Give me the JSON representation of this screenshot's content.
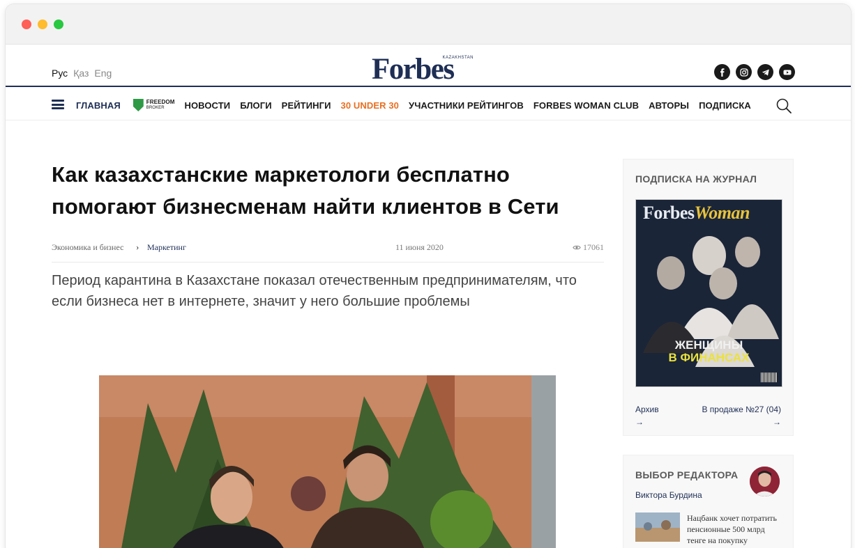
{
  "langs": [
    {
      "label": "Рус",
      "active": true
    },
    {
      "label": "Қаз",
      "active": false
    },
    {
      "label": "Eng",
      "active": false
    }
  ],
  "logo": {
    "word": "Forbes",
    "sub": "KAZAKHSTAN"
  },
  "socials": [
    "facebook-icon",
    "instagram-icon",
    "telegram-icon",
    "youtube-icon"
  ],
  "nav": {
    "home": "ГЛАВНАЯ",
    "partner_name": "FREEDOM",
    "partner_sub": "BROKER",
    "news": "НОВОСТИ",
    "blogs": "БЛОГИ",
    "ratings": "РЕЙТИНГИ",
    "under30": "30 UNDER 30",
    "participants": "УЧАСТНИКИ РЕЙТИНГОВ",
    "woman_club": "FORBES WOMAN CLUB",
    "authors": "АВТОРЫ",
    "subscribe": "ПОДПИСКА"
  },
  "colors": {
    "brand": "#1e2e55",
    "accent": "#e86f22",
    "partner": "#2f9a46"
  },
  "article": {
    "title": "Как казахстанские маркетологи бесплатно помогают бизнесменам найти клиентов в Сети",
    "category": "Экономика и бизнес",
    "subcategory": "Маркетинг",
    "date": "11 июня 2020",
    "views": "17061",
    "lead": "Период карантина в Казахстане показал отечественным предпринимателям, что если бизнеса нет в интернете, значит у него большие проблемы"
  },
  "sidebar": {
    "subscription_title": "ПОДПИСКА НА ЖУРНАЛ",
    "cover": {
      "mast_a": "Forbes",
      "mast_b": "Woman",
      "headline_1": "ЖЕНЩИНЫ",
      "headline_2": "В ФИНАНСАХ"
    },
    "archive": "Архив",
    "on_sale": "В продаже №27 (04)",
    "arrow": "→",
    "editor_title": "ВЫБОР РЕДАКТОРА",
    "editor_name": "Виктора Бурдина",
    "editor_news": "Нацбанк хочет потратить пенсионные 500 млрд тенге на покупку"
  }
}
